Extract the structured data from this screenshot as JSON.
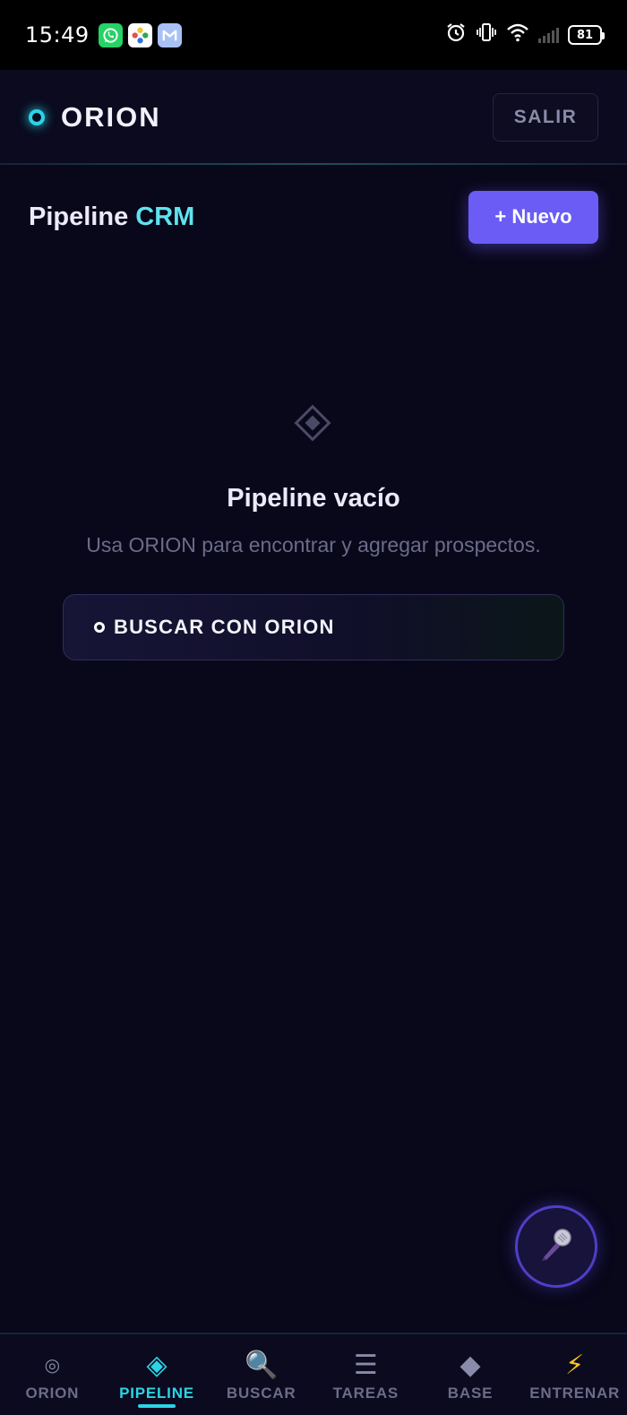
{
  "status_bar": {
    "time": "15:49",
    "battery": "81",
    "notifications": [
      "whatsapp-icon",
      "pinwheel-icon",
      "mail-icon"
    ]
  },
  "header": {
    "logo": "ORION",
    "logout_label": "SALIR"
  },
  "page": {
    "title_main": "Pipeline ",
    "title_accent": "CRM",
    "new_button": "+ Nuevo"
  },
  "empty_state": {
    "title": "Pipeline vacío",
    "subtitle": "Usa ORION para encontrar y agregar prospectos.",
    "cta": "BUSCAR CON ORION"
  },
  "fab": {
    "icon": "microphone-icon"
  },
  "nav": {
    "items": [
      {
        "label": "ORION",
        "icon": "orion-icon",
        "glyph": "◎"
      },
      {
        "label": "PIPELINE",
        "icon": "pipeline-icon",
        "glyph": "◈"
      },
      {
        "label": "BUSCAR",
        "icon": "search-icon",
        "glyph": "🔍"
      },
      {
        "label": "TAREAS",
        "icon": "tasks-icon",
        "glyph": "☰"
      },
      {
        "label": "BASE",
        "icon": "base-icon",
        "glyph": "◆"
      },
      {
        "label": "ENTRENAR",
        "icon": "lightning-icon",
        "glyph": "⚡"
      }
    ],
    "active_index": 1
  },
  "colors": {
    "background": "#09071a",
    "accent_cyan": "#2ad4e6",
    "accent_purple": "#6a5cf5"
  }
}
